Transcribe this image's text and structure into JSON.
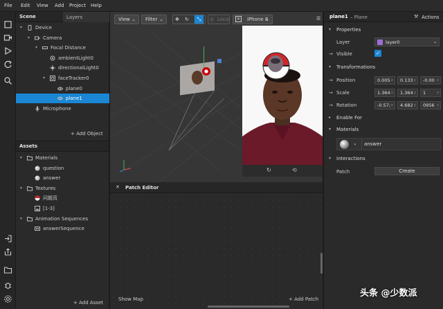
{
  "menu": [
    "File",
    "Edit",
    "View",
    "Add",
    "Project",
    "Help"
  ],
  "scene": {
    "tab_title": "Scene",
    "tab_layers": "Layers",
    "tree": [
      {
        "label": "Device",
        "depth": 0,
        "arrow": "▾",
        "icon": "device-icon"
      },
      {
        "label": "Camera",
        "depth": 1,
        "arrow": "▾",
        "icon": "camera-icon"
      },
      {
        "label": "Focal Distance",
        "depth": 2,
        "arrow": "▾",
        "icon": "focal-distance-icon"
      },
      {
        "label": "ambientLight0",
        "depth": 3,
        "arrow": "",
        "icon": "ambient-light-icon"
      },
      {
        "label": "directionalLight0",
        "depth": 3,
        "arrow": "",
        "icon": "directional-light-icon"
      },
      {
        "label": "faceTracker0",
        "depth": 3,
        "arrow": "▾",
        "icon": "face-tracker-icon"
      },
      {
        "label": "plane0",
        "depth": 4,
        "arrow": "",
        "icon": "eye-icon"
      },
      {
        "label": "plane1",
        "depth": 4,
        "arrow": "",
        "icon": "eye-icon",
        "selected": true
      },
      {
        "label": "Microphone",
        "depth": 1,
        "arrow": "",
        "icon": "microphone-icon"
      }
    ],
    "add_object": "+ Add Object"
  },
  "assets": {
    "title": "Assets",
    "tree": [
      {
        "label": "Materials",
        "depth": 0,
        "arrow": "▾",
        "icon": "folder-icon"
      },
      {
        "label": "question",
        "depth": 1,
        "arrow": "",
        "icon": "material-icon"
      },
      {
        "label": "answer",
        "depth": 1,
        "arrow": "",
        "icon": "material-icon"
      },
      {
        "label": "Textures",
        "depth": 0,
        "arrow": "▾",
        "icon": "folder-icon"
      },
      {
        "label": "问题页",
        "depth": 1,
        "arrow": "",
        "icon": "texture-icon"
      },
      {
        "label": "[1-3]",
        "depth": 1,
        "arrow": "",
        "icon": "texture-sequence-icon"
      },
      {
        "label": "Animation Sequences",
        "depth": 0,
        "arrow": "▾",
        "icon": "folder-icon"
      },
      {
        "label": "answerSequence",
        "depth": 1,
        "arrow": "",
        "icon": "animation-sequence-icon"
      }
    ],
    "add_asset": "+ Add Asset"
  },
  "viewport": {
    "view_label": "View",
    "filter_label": "Filter",
    "local_label": "Local",
    "device_label": "iPhone 8"
  },
  "patch": {
    "title": "Patch Editor",
    "show_map": "Show Map",
    "add_patch": "+ Add Patch"
  },
  "inspector": {
    "object_name": "plane1",
    "object_type": "– Plane",
    "actions": "Actions",
    "properties_title": "Properties",
    "layer_label": "Layer",
    "layer_value": "layer0",
    "visible_label": "Visible",
    "transformations_title": "Transformations",
    "position_label": "Position",
    "position": [
      "0.005",
      "0.133",
      "-0.00"
    ],
    "scale_label": "Scale",
    "scale": [
      "1.364",
      "1.364",
      "1"
    ],
    "rotation_label": "Rotation",
    "rotation": [
      "-0.57;",
      "4.682",
      "0956"
    ],
    "axis": [
      "x",
      "y",
      "z"
    ],
    "enable_for_title": "Enable For",
    "materials_title": "Materials",
    "material_value": "answer",
    "interactions_title": "Interactions",
    "patch_label": "Patch",
    "create_label": "Create"
  },
  "watermark": "头条 @少数派",
  "colors": {
    "accent": "#1b87d4",
    "layer": "#9b6fd4"
  }
}
